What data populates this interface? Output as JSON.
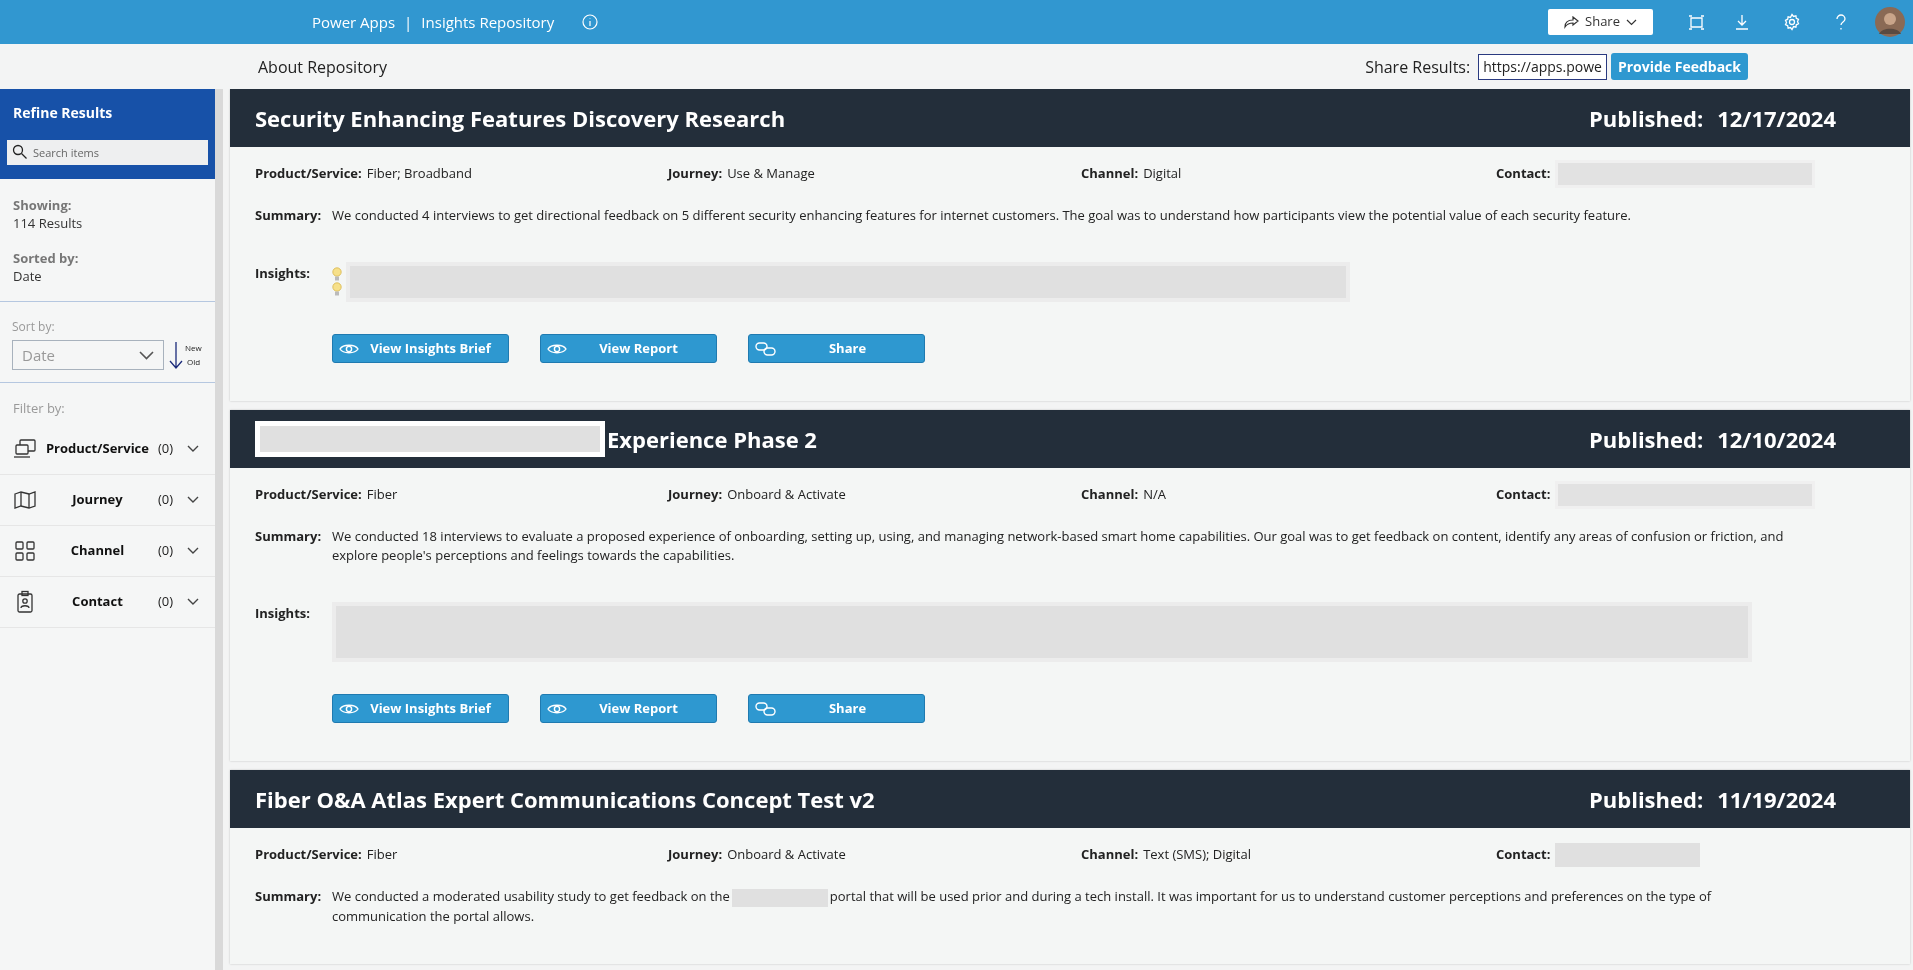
{
  "top_bar": {
    "app_name": "Power Apps",
    "separator": "|",
    "title": "Insights Repository",
    "share_button": "Share"
  },
  "sub_bar": {
    "about_link": "About Repository",
    "share_label": "Share Results:",
    "share_url": "https://apps.powe",
    "feedback_button": "Provide Feedback"
  },
  "sidebar": {
    "title": "Refine Results",
    "search": {
      "placeholder": "Search items"
    },
    "showing_label": "Showing:",
    "showing_value": "114 Results",
    "sorted_label": "Sorted by:",
    "sorted_value": "Date",
    "sort_label": "Sort by:",
    "sort_select": "Date",
    "order_new": "New",
    "order_old": "Old",
    "filter_label": "Filter by:",
    "filters": [
      {
        "kind": "laptop",
        "label": "Product/Service",
        "count": "(0)",
        "expanded": false
      },
      {
        "kind": "map",
        "label": "Journey",
        "count": "(0)",
        "expanded": false
      },
      {
        "kind": "grid",
        "label": "Channel",
        "count": "(0)",
        "expanded": false
      },
      {
        "kind": "badge",
        "label": "Contact",
        "count": "(0)",
        "expanded": false
      }
    ]
  },
  "results": [
    {
      "title": "Security Enhancing Features Discovery Research",
      "title_redacted": false,
      "published_label": "Published:",
      "date": "12/17/2024",
      "fields": [
        {
          "label": "Product/Service:",
          "value": "Fiber; Broadband"
        },
        {
          "label": "Journey:",
          "value": "Use & Manage"
        },
        {
          "label": "Channel:",
          "value": "Digital"
        }
      ],
      "contact_label": "Contact:",
      "summary_label": "Summary:",
      "summary": [
        {
          "kind": "text",
          "text": "We conducted 4 interviews to get directional feedback on 5 different security enhancing features for internet customers. The goal was to understand how participants view the potential value of each security feature."
        }
      ],
      "insights_label": "Insights:",
      "insight_bulbs": true,
      "buttons": [
        {
          "kind": "eye",
          "label": "View Insights Brief"
        },
        {
          "kind": "eye",
          "label": "View Report"
        },
        {
          "kind": "link",
          "label": "Share"
        }
      ]
    },
    {
      "title": "Experience Phase 2",
      "title_redacted": true,
      "published_label": "Published:",
      "date": "12/10/2024",
      "fields": [
        {
          "label": "Product/Service:",
          "value": "Fiber"
        },
        {
          "label": "Journey:",
          "value": "Onboard & Activate"
        },
        {
          "label": "Channel:",
          "value": "N/A"
        }
      ],
      "contact_label": "Contact:",
      "summary_label": "Summary:",
      "summary": [
        {
          "kind": "text",
          "text": "We conducted 18 interviews to evaluate a proposed experience of onboarding, setting up, using, and managing network-based smart home capabilities. Our goal was to get feedback on content, identify any areas of confusion or friction, and explore people's perceptions and feelings towards the capabilities."
        }
      ],
      "insights_label": "Insights:",
      "insight_bulbs": false,
      "buttons": [
        {
          "kind": "eye",
          "label": "View Insights Brief"
        },
        {
          "kind": "eye",
          "label": "View Report"
        },
        {
          "kind": "link",
          "label": "Share"
        }
      ]
    },
    {
      "title": "Fiber O&A Atlas Expert Communications Concept Test v2",
      "title_redacted": false,
      "published_label": "Published:",
      "date": "11/19/2024",
      "fields": [
        {
          "label": "Product/Service:",
          "value": "Fiber"
        },
        {
          "label": "Journey:",
          "value": "Onboard & Activate"
        },
        {
          "label": "Channel:",
          "value": "Text (SMS); Digital"
        }
      ],
      "contact_label": "Contact:",
      "summary_label": "Summary:",
      "summary": [
        {
          "kind": "text",
          "text": "We conducted a moderated usability study to get feedback on the"
        },
        {
          "kind": "redacted"
        },
        {
          "kind": "text",
          "text": "portal that will be used prior and during a tech install. It was important for us to understand customer perceptions and preferences on the type of communication the portal allows."
        }
      ]
    }
  ]
}
